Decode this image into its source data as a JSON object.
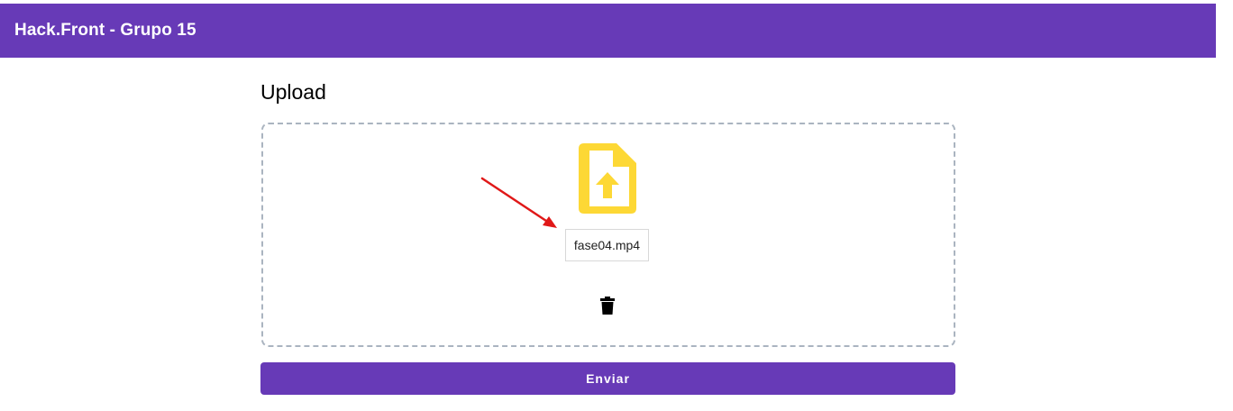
{
  "header": {
    "title": "Hack.Front - Grupo 15",
    "color": "#673ab7"
  },
  "main": {
    "title": "Upload",
    "dropzone": {
      "border_color": "#aab4c0",
      "file_icon": "file-upload-icon",
      "file_icon_color": "#fdd835",
      "file_name": "fase04.mp4",
      "delete_icon": "trash-icon"
    },
    "submit_label": "Enviar"
  },
  "annotation": {
    "icon": "red-arrow",
    "color": "#e01818"
  }
}
